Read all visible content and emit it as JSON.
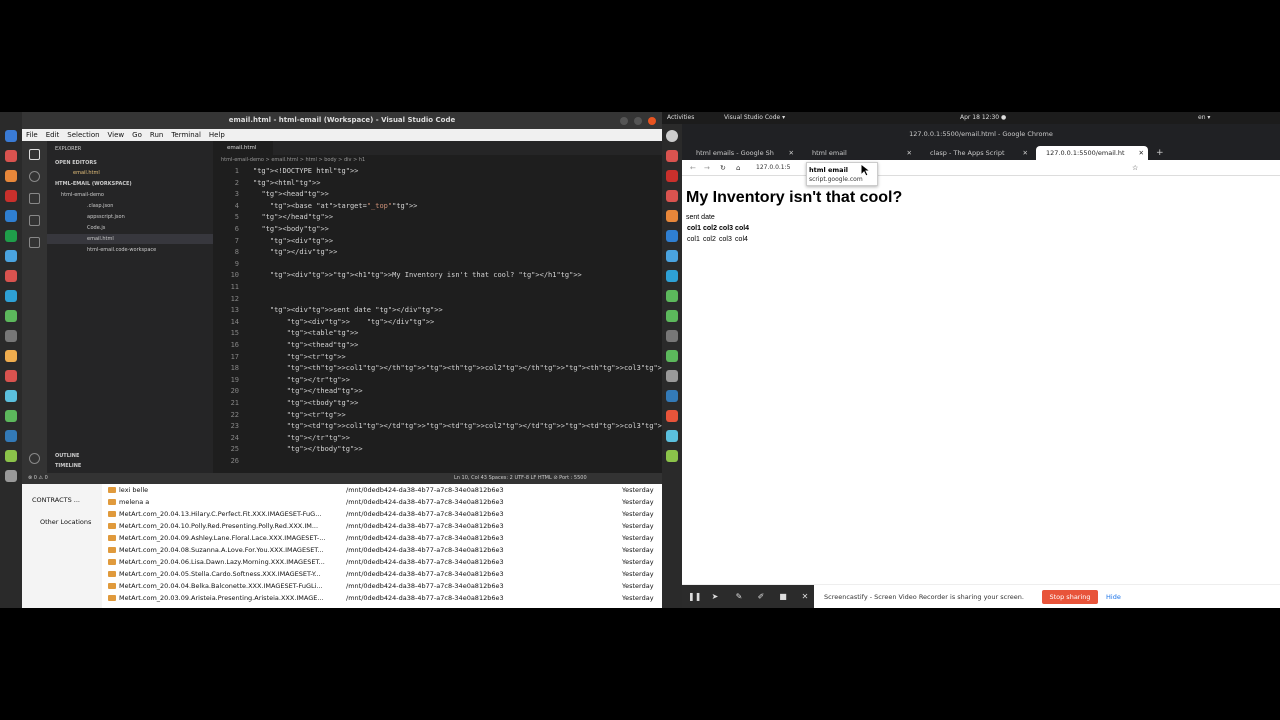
{
  "vscode": {
    "title": "email.html - html-email (Workspace) - Visual Studio Code",
    "menu": [
      "File",
      "Edit",
      "Selection",
      "View",
      "Go",
      "Run",
      "Terminal",
      "Help"
    ],
    "sidebar": {
      "explorer_label": "EXPLORER",
      "open_editors": "OPEN EDITORS",
      "open_file": "email.html",
      "workspace": "HTML-EMAIL (WORKSPACE)",
      "folder": "html-email-demo",
      "files": [
        ".clasp.json",
        "appsscript.json",
        "Code.js",
        "email.html",
        "html-email.code-workspace"
      ],
      "outline": "OUTLINE",
      "timeline": "TIMELINE"
    },
    "tab": "email.html",
    "breadcrumb": "html-email-demo > email.html > html > body > div > h1",
    "status_left": "⊗ 0 ⚠ 0",
    "status_right": "Ln 10, Col 43   Spaces: 2   UTF-8   LF   HTML   ⊘ Port : 5500",
    "lines": [
      {
        "n": "1",
        "t": "<!DOCTYPE html>"
      },
      {
        "n": "2",
        "t": "<html>"
      },
      {
        "n": "3",
        "t": "  <head>"
      },
      {
        "n": "4",
        "t": "    <base target=\"_top\">"
      },
      {
        "n": "5",
        "t": "  </head>"
      },
      {
        "n": "6",
        "t": "  <body>"
      },
      {
        "n": "7",
        "t": "    <div>"
      },
      {
        "n": "8",
        "t": "    </div>"
      },
      {
        "n": "9",
        "t": ""
      },
      {
        "n": "10",
        "t": "    <div><h1>My Inventory isn't that cool? </h1>"
      },
      {
        "n": "11",
        "t": ""
      },
      {
        "n": "12",
        "t": ""
      },
      {
        "n": "13",
        "t": "    <div>sent date </div>"
      },
      {
        "n": "14",
        "t": "        <div>    </div>"
      },
      {
        "n": "15",
        "t": "        <table>"
      },
      {
        "n": "16",
        "t": "        <thead>"
      },
      {
        "n": "17",
        "t": "        <tr>"
      },
      {
        "n": "18",
        "t": "        <th>col1</th><th>col2</th><th>col3</th><th>col4</th>"
      },
      {
        "n": "19",
        "t": "        </tr>"
      },
      {
        "n": "20",
        "t": "        </thead>"
      },
      {
        "n": "21",
        "t": "        <tbody>"
      },
      {
        "n": "22",
        "t": "        <tr>"
      },
      {
        "n": "23",
        "t": "        <td>col1</td><td>col2</td><td>col3</td><td>col4</td>"
      },
      {
        "n": "24",
        "t": "        </tr>"
      },
      {
        "n": "25",
        "t": "        </tbody>"
      },
      {
        "n": "26",
        "t": ""
      }
    ]
  },
  "files": {
    "sidebar": [
      "CONTRACTS ...",
      "Other Locations"
    ],
    "rows": [
      {
        "name": "lexi belle",
        "path": "/mnt/0dedb424-da38-4b77-a7c8-34e0a812b6e3",
        "date": "Yesterday"
      },
      {
        "name": "melena a",
        "path": "/mnt/0dedb424-da38-4b77-a7c8-34e0a812b6e3",
        "date": "Yesterday"
      },
      {
        "name": "MetArt.com_20.04.13.Hilary.C.Perfect.Fit.XXX.IMAGESET-FuG...",
        "path": "/mnt/0dedb424-da38-4b77-a7c8-34e0a812b6e3",
        "date": "Yesterday"
      },
      {
        "name": "MetArt.com_20.04.10.Polly.Red.Presenting.Polly.Red.XXX.IM...",
        "path": "/mnt/0dedb424-da38-4b77-a7c8-34e0a812b6e3",
        "date": "Yesterday"
      },
      {
        "name": "MetArt.com_20.04.09.Ashley.Lane.Floral.Lace.XXX.IMAGESET-...",
        "path": "/mnt/0dedb424-da38-4b77-a7c8-34e0a812b6e3",
        "date": "Yesterday"
      },
      {
        "name": "MetArt.com_20.04.08.Suzanna.A.Love.For.You.XXX.IMAGESET...",
        "path": "/mnt/0dedb424-da38-4b77-a7c8-34e0a812b6e3",
        "date": "Yesterday"
      },
      {
        "name": "MetArt.com_20.04.06.Lisa.Dawn.Lazy.Morning.XXX.IMAGESET...",
        "path": "/mnt/0dedb424-da38-4b77-a7c8-34e0a812b6e3",
        "date": "Yesterday"
      },
      {
        "name": "MetArt.com_20.04.05.Stella.Cardo.Softness.XXX.IMAGESET-Y...",
        "path": "/mnt/0dedb424-da38-4b77-a7c8-34e0a812b6e3",
        "date": "Yesterday"
      },
      {
        "name": "MetArt.com_20.04.04.Belka.Balconette.XXX.IMAGESET-FuGLi...",
        "path": "/mnt/0dedb424-da38-4b77-a7c8-34e0a812b6e3",
        "date": "Yesterday"
      },
      {
        "name": "MetArt.com_20.03.09.Aristeia.Presenting.Aristeia.XXX.IMAGE...",
        "path": "/mnt/0dedb424-da38-4b77-a7c8-34e0a812b6e3",
        "date": "Yesterday"
      }
    ]
  },
  "topbar": {
    "activities": "Activities",
    "app": "Visual Studio Code ▾",
    "clock": "Apr 18  12:30 ●",
    "lang": "en ▾"
  },
  "chrome": {
    "title": "127.0.0.1:5500/email.html - Google Chrome",
    "tabs": [
      "html emails - Google Sh",
      "html email",
      "clasp - The Apps Script",
      "127.0.0.1:5500/email.ht"
    ],
    "address": "127.0.0.1:5",
    "tooltip_title": "html email",
    "tooltip_sub": "script.google.com",
    "page": {
      "heading": "My Inventory isn't that cool?",
      "sent_date": "sent date",
      "headers": [
        "col1",
        "col2",
        "col3",
        "col4"
      ],
      "cells": [
        "col1",
        "col2",
        "col3",
        "col4"
      ]
    }
  },
  "share": {
    "message": "Screencastify - Screen Video Recorder is sharing your screen.",
    "stop": "Stop sharing",
    "hide": "Hide"
  }
}
